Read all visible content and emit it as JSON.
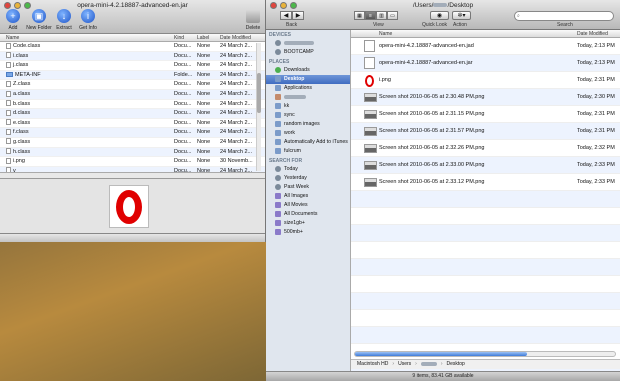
{
  "archive": {
    "title": "opera-mini-4.2.18887-advanced-en.jar",
    "toolbar": [
      {
        "label": "Add",
        "icon": "plus-icon",
        "glyph": "+"
      },
      {
        "label": "New Folder",
        "icon": "folder-icon",
        "glyph": "▣"
      },
      {
        "label": "Extract",
        "icon": "extract-icon",
        "glyph": "↓"
      },
      {
        "label": "Get Info",
        "icon": "info-icon",
        "glyph": "i"
      }
    ],
    "delete_label": "Delete",
    "columns": [
      "Name",
      "Kind",
      "Label",
      "Date Modified"
    ],
    "rows": [
      {
        "name": "Code.class",
        "kind": "Docu...",
        "label": "None",
        "date": "24 March 2..."
      },
      {
        "name": "i.class",
        "kind": "Docu...",
        "label": "None",
        "date": "24 March 2..."
      },
      {
        "name": "j.class",
        "kind": "Docu...",
        "label": "None",
        "date": "24 March 2..."
      },
      {
        "name": "META-INF",
        "kind": "Folde...",
        "label": "None",
        "date": "24 March 2..."
      },
      {
        "name": "Z.class",
        "kind": "Docu...",
        "label": "None",
        "date": "24 March 2..."
      },
      {
        "name": "a.class",
        "kind": "Docu...",
        "label": "None",
        "date": "24 March 2..."
      },
      {
        "name": "b.class",
        "kind": "Docu...",
        "label": "None",
        "date": "24 March 2..."
      },
      {
        "name": "d.class",
        "kind": "Docu...",
        "label": "None",
        "date": "24 March 2..."
      },
      {
        "name": "e.class",
        "kind": "Docu...",
        "label": "None",
        "date": "24 March 2..."
      },
      {
        "name": "f.class",
        "kind": "Docu...",
        "label": "None",
        "date": "24 March 2..."
      },
      {
        "name": "g.class",
        "kind": "Docu...",
        "label": "None",
        "date": "24 March 2..."
      },
      {
        "name": "h.class",
        "kind": "Docu...",
        "label": "None",
        "date": "24 March 2..."
      },
      {
        "name": "i.png",
        "kind": "Docu...",
        "label": "None",
        "date": "30 Novemb..."
      },
      {
        "name": "v",
        "kind": "Docu...",
        "label": "None",
        "date": "24 March 2..."
      }
    ]
  },
  "finder": {
    "title": "/Users/",
    "title_tail": "/Desktop",
    "labels": {
      "back": "Back",
      "view": "View",
      "quicklook": "Quick Look",
      "action": "Action",
      "search": "Search"
    },
    "devices_header": "DEVICES",
    "devices": [
      "BOOTCAMP"
    ],
    "places_header": "PLACES",
    "places": [
      "Downloads",
      "Desktop",
      "Applications",
      "kk",
      "sync",
      "random images",
      "work",
      "Automatically Add to iTunes",
      "fulcrum"
    ],
    "search_header": "SEARCH FOR",
    "searches": [
      "Today",
      "Yesterday",
      "Past Week",
      "All Images",
      "All Movies",
      "All Documents",
      "size1gb+",
      "500mb+"
    ],
    "columns": [
      "Name",
      "Date Modified"
    ],
    "files": [
      {
        "name": "opera-mini-4.2.18887-advanced-en.jad",
        "date": "Today, 2:13 PM",
        "icon": "document-icon"
      },
      {
        "name": "opera-mini-4.2.18887-advanced-en.jar",
        "date": "Today, 2:13 PM",
        "icon": "document-icon"
      },
      {
        "name": "i.png",
        "date": "Today, 2:31 PM",
        "icon": "opera-logo-icon"
      },
      {
        "name": "Screen shot 2010-06-05 at 2.30.48 PM.png",
        "date": "Today, 2:30 PM",
        "icon": "screenshot-icon"
      },
      {
        "name": "Screen shot 2010-06-05 at 2.31.15 PM.png",
        "date": "Today, 2:31 PM",
        "icon": "screenshot-icon"
      },
      {
        "name": "Screen shot 2010-06-05 at 2.31.57 PM.png",
        "date": "Today, 2:31 PM",
        "icon": "screenshot-icon"
      },
      {
        "name": "Screen shot 2010-06-05 at 2.32.26 PM.png",
        "date": "Today, 2:32 PM",
        "icon": "screenshot-icon"
      },
      {
        "name": "Screen shot 2010-06-05 at 2.33.00 PM.png",
        "date": "Today, 2:33 PM",
        "icon": "screenshot-icon"
      },
      {
        "name": "Screen shot 2010-06-05 at 2.33.12 PM.png",
        "date": "Today, 2:33 PM",
        "icon": "screenshot-icon"
      }
    ],
    "path": [
      "Macintosh HD",
      "Users",
      "Desktop"
    ],
    "status": "9 items, 83.41 GB available"
  },
  "colors": {
    "selection": "#3f6cc0",
    "opera_red": "#e00000"
  }
}
